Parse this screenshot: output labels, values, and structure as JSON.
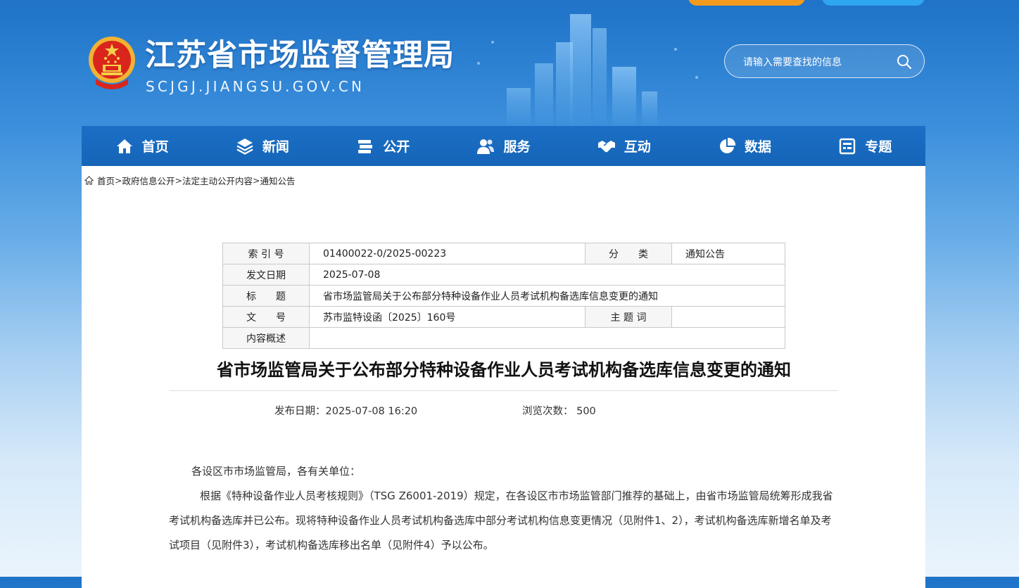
{
  "header": {
    "site_title": "江苏省市场监督管理局",
    "domain": "SCJGJ.JIANGSU.GOV.CN",
    "search_placeholder": "请输入需要查找的信息",
    "colors": {
      "header_blue": "#1f73c8",
      "nav_blue": "#1b6fc5",
      "top_orange": "#f39a1d",
      "top_blue": "#2ea6f0"
    }
  },
  "nav": {
    "items": [
      {
        "label": "首页",
        "icon": "home-icon"
      },
      {
        "label": "新闻",
        "icon": "layers-icon"
      },
      {
        "label": "公开",
        "icon": "books-icon"
      },
      {
        "label": "服务",
        "icon": "people-icon"
      },
      {
        "label": "互动",
        "icon": "handshake-icon"
      },
      {
        "label": "数据",
        "icon": "pie-chart-icon"
      },
      {
        "label": "专题",
        "icon": "calendar-icon"
      }
    ]
  },
  "breadcrumb": [
    "首页",
    "政府信息公开",
    "法定主动公开内容",
    "通知公告"
  ],
  "meta": {
    "index_label": "索 引 号",
    "index_value": "01400022-0/2025-00223",
    "category_label": "分　　类",
    "category_value": "通知公告",
    "date_label": "发文日期",
    "date_value": "2025-07-08",
    "title_label": "标　　题",
    "title_value": "省市场监管局关于公布部分特种设备作业人员考试机构备选库信息变更的通知",
    "docno_label": "文　　号",
    "docno_value": "苏市监特设函〔2025〕160号",
    "keywords_label": "主 题 词",
    "keywords_value": "",
    "summary_label": "内容概述",
    "summary_value": ""
  },
  "article": {
    "title": "省市场监管局关于公布部分特种设备作业人员考试机构备选库信息变更的通知",
    "publish_date": "发布日期：2025-07-08 16:20",
    "views": "浏览次数： 500",
    "salutation": "各设区市市场监管局，各有关单位：",
    "paragraph": "根据《特种设备作业人员考核规则》（TSG Z6001-2019）规定，在各设区市市场监管部门推荐的基础上，由省市场监管局统筹形成我省考试机构备选库并已公布。现将特种设备作业人员考试机构备选库中部分考试机构信息变更情况（见附件1、2），考试机构备选库新增名单及考试项目（见附件3），考试机构备选库移出名单（见附件4）予以公布。"
  }
}
